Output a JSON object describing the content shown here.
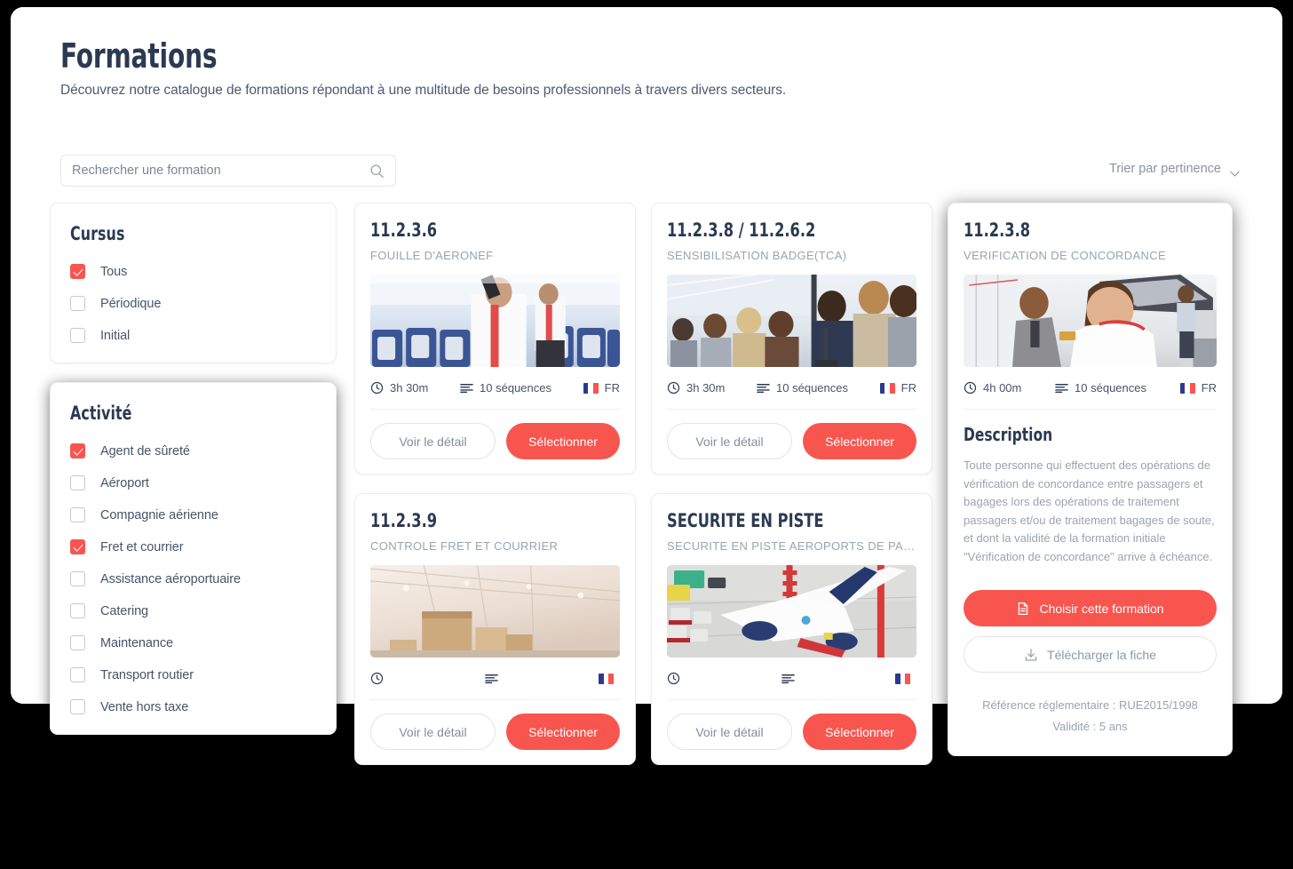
{
  "header": {
    "title": "Formations",
    "subtitle": "Découvrez notre catalogue de formations répondant à une multitude de besoins professionnels à travers divers secteurs."
  },
  "search": {
    "placeholder": "Rechercher une formation",
    "value": "",
    "icon": "search-icon"
  },
  "sort": {
    "label": "Trier par pertinence",
    "icon": "chevron-down-icon"
  },
  "filters": [
    {
      "title": "Cursus",
      "options": [
        {
          "label": "Tous",
          "checked": true
        },
        {
          "label": "Périodique",
          "checked": false
        },
        {
          "label": "Initial",
          "checked": false
        }
      ]
    },
    {
      "title": "Activité",
      "options": [
        {
          "label": "Agent de sûreté",
          "checked": true
        },
        {
          "label": "Aéroport",
          "checked": false
        },
        {
          "label": "Compagnie aérienne",
          "checked": false
        },
        {
          "label": "Fret et courrier",
          "checked": true
        },
        {
          "label": "Assistance aéroportuaire",
          "checked": false
        },
        {
          "label": "Catering",
          "checked": false
        },
        {
          "label": "Maintenance",
          "checked": false
        },
        {
          "label": "Transport routier",
          "checked": false
        },
        {
          "label": "Vente hors taxe",
          "checked": false
        }
      ]
    }
  ],
  "courses": [
    {
      "code": "11.2.3.6",
      "name": "FOUILLE D'AERONEF",
      "duration": "3h 30m",
      "sequences": "10 séquences",
      "language": "FR",
      "photo": "aircraft-cabin-search",
      "detail_label": "Voir le détail",
      "select_label": "Sélectionner"
    },
    {
      "code": "11.2.3.8 / 11.2.6.2",
      "name": "SENSIBILISATION BADGE(TCA)",
      "duration": "3h 30m",
      "sequences": "10 séquences",
      "language": "FR",
      "photo": "airport-queue",
      "detail_label": "Voir le détail",
      "select_label": "Sélectionner"
    },
    {
      "code": "11.2.3.9",
      "name": "CONTROLE FRET ET COURRIER",
      "duration": "",
      "sequences": "",
      "language": "",
      "photo": "cargo-warehouse",
      "detail_label": "Voir le détail",
      "select_label": "Sélectionner"
    },
    {
      "code": "SECURITE EN PISTE",
      "name": "SECURITE EN PISTE AEROPORTS DE PARIS",
      "duration": "",
      "sequences": "",
      "language": "",
      "photo": "apron-aircraft",
      "detail_label": "Voir le détail",
      "select_label": "Sélectionner"
    }
  ],
  "detail": {
    "code": "11.2.3.8",
    "name": "VERIFICATION DE CONCORDANCE",
    "duration": "4h 00m",
    "sequences": "10 séquences",
    "language": "FR",
    "photo": "passenger-id-check",
    "description_title": "Description",
    "description": "Toute personne qui effectuent des opérations de vérification de concordance entre passagers et bagages lors des opérations de traitement passagers et/ou de traitement bagages de soute, et dont la validité de la formation initiale \"Vérification de concordance\" arrive à échéance.",
    "choose_label": "Choisir cette formation",
    "choose_icon": "document-icon",
    "download_label": "Télécharger la fiche",
    "download_icon": "download-icon",
    "reference": "Référence réglementaire : RUE2015/1998",
    "validity": "Validité : 5 ans"
  },
  "colors": {
    "accent": "#f9554f",
    "heading": "#2b3a52",
    "muted": "#9aa3b2",
    "border": "#eceef1",
    "flag_blue": "#2b3a8f"
  }
}
